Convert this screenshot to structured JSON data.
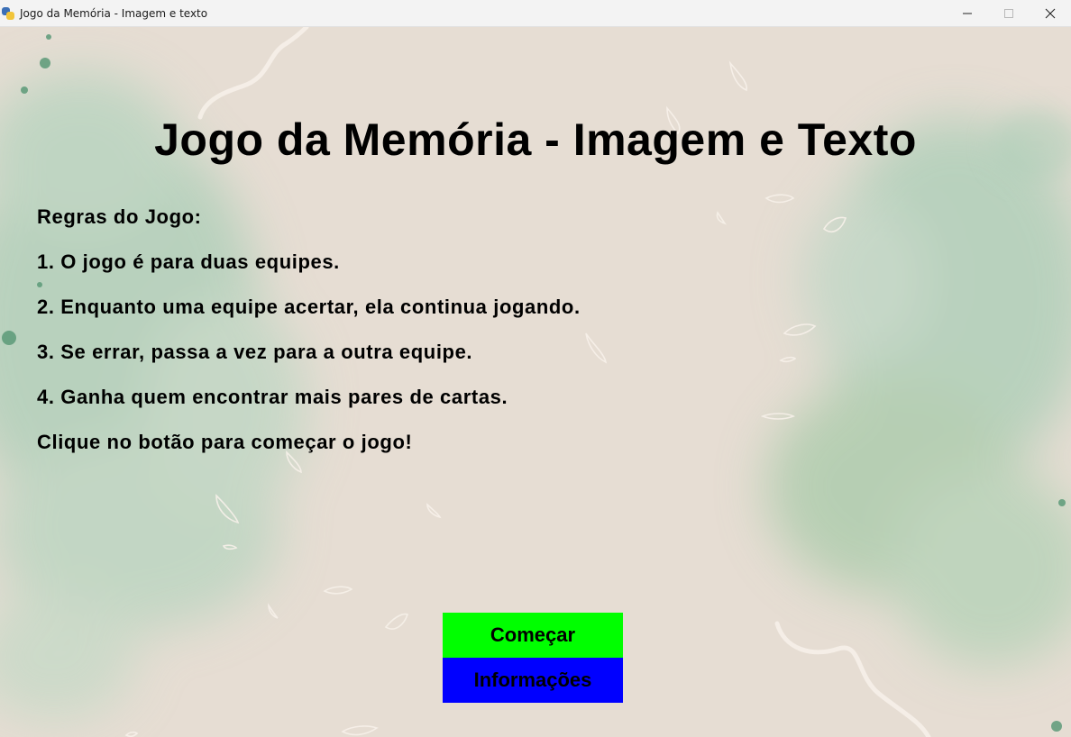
{
  "window": {
    "title": "Jogo da Memória - Imagem e texto"
  },
  "icons": {
    "app": "python-snake-icon",
    "minimize": "minimize-icon",
    "maximize": "maximize-icon",
    "close": "close-icon"
  },
  "game": {
    "title": "Jogo da Memória - Imagem e Texto",
    "rules": [
      "Regras do Jogo:",
      "1. O jogo é para duas equipes.",
      "2. Enquanto uma equipe acertar, ela continua jogando.",
      "3. Se errar, passa a vez para a outra equipe.",
      "4. Ganha quem encontrar mais pares de cartas.",
      "Clique no botão para começar o jogo!"
    ],
    "buttons": {
      "start_label": "Começar",
      "info_label": "Informações"
    }
  },
  "colors": {
    "background": "#e6ddd3",
    "start_button": "#00ff00",
    "info_button": "#0000ff",
    "watercolor": "#a9cdb6"
  }
}
